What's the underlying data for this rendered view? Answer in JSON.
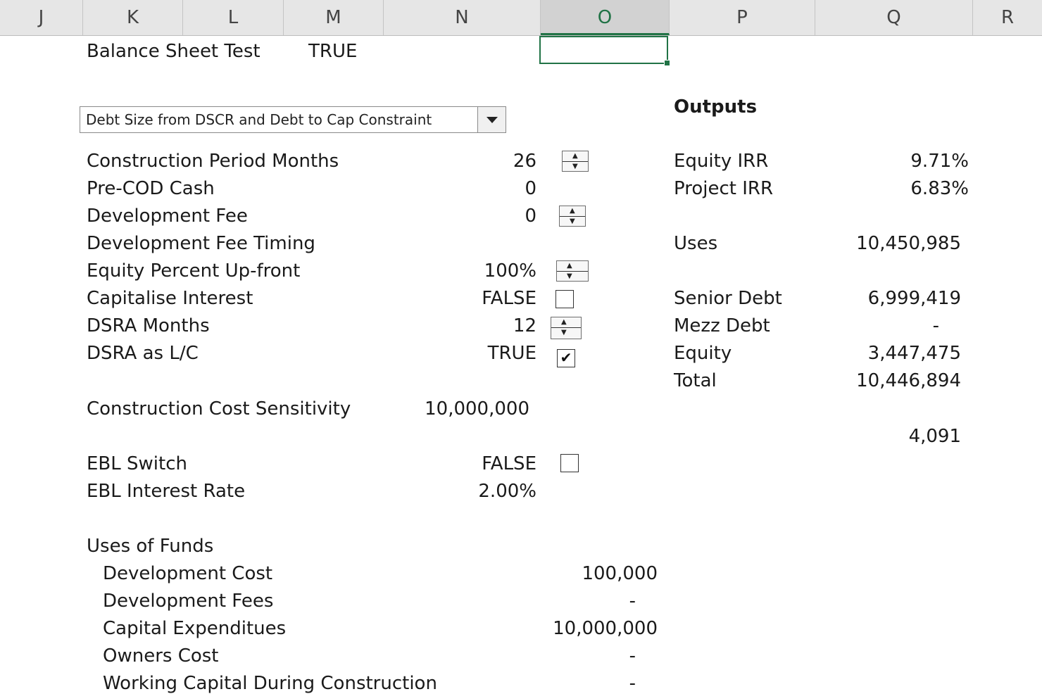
{
  "columns": [
    "J",
    "K",
    "L",
    "M",
    "N",
    "O",
    "P",
    "Q",
    "R"
  ],
  "top": {
    "label": "Balance Sheet Test",
    "value": "TRUE"
  },
  "dropdown": {
    "selected": "Debt Size from DSCR and Debt to Cap Constraint"
  },
  "inputs": [
    {
      "label": "Construction Period Months",
      "value": "26"
    },
    {
      "label": "Pre-COD Cash",
      "value": "0"
    },
    {
      "label": "Development Fee",
      "value": "0"
    },
    {
      "label": "Development Fee Timing",
      "value": ""
    },
    {
      "label": "Equity Percent Up-front",
      "value": "100%"
    },
    {
      "label": "Capitalise Interest",
      "value": "FALSE"
    },
    {
      "label": "DSRA Months",
      "value": "12"
    },
    {
      "label": "DSRA as L/C",
      "value": "TRUE"
    }
  ],
  "sensitivity": {
    "label": "Construction Cost Sensitivity",
    "value": "10,000,000"
  },
  "ebl": [
    {
      "label": "EBL Switch",
      "value": "FALSE"
    },
    {
      "label": "EBL Interest Rate",
      "value": "2.00%"
    }
  ],
  "uses_of_funds": {
    "title": "Uses of Funds",
    "rows": [
      {
        "label": "Development Cost",
        "value": "100,000"
      },
      {
        "label": "Development Fees",
        "value": "-"
      },
      {
        "label": "Capital Expenditues",
        "value": "10,000,000"
      },
      {
        "label": "Owners Cost",
        "value": "-"
      },
      {
        "label": "Working Capital During Construction",
        "value": "-"
      }
    ]
  },
  "outputs": {
    "title": "Outputs",
    "irr": [
      {
        "label": "Equity IRR",
        "value": "9.71%"
      },
      {
        "label": "Project IRR",
        "value": "6.83%"
      }
    ],
    "uses": {
      "label": "Uses",
      "value": "10,450,985"
    },
    "funding": [
      {
        "label": "Senior Debt",
        "value": "6,999,419"
      },
      {
        "label": "Mezz Debt",
        "value": "-"
      },
      {
        "label": "Equity",
        "value": "3,447,475"
      },
      {
        "label": "Total",
        "value": "10,446,894"
      }
    ],
    "difference": "4,091"
  },
  "checkboxes": {
    "capitalise_interest": false,
    "dsra_lc": true,
    "ebl_switch": false
  },
  "colors": {
    "accent": "#217346",
    "header_bg": "#e6e6e6"
  }
}
